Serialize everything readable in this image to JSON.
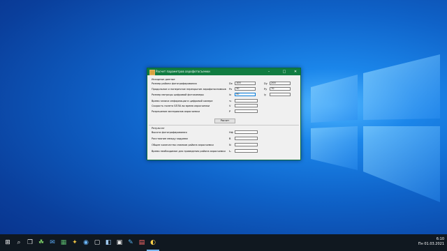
{
  "window": {
    "title": "Расчет параметров аэрофотосъемки",
    "minimize": "–",
    "maximize": "□",
    "close": "✕"
  },
  "input_section": {
    "heading": "Исходные данные",
    "rows": [
      {
        "label": "Размер района фотографирования",
        "sym1": "Dx",
        "val1": "100",
        "sym2": "Dy",
        "val2": "200"
      },
      {
        "label": "Продольное и поперечное перекрытие аэрофотоснимков",
        "sym1": "Px",
        "val1": "30",
        "sym2": "Py",
        "val2": "70"
      },
      {
        "label": "Размер матрицы цифровой фотокамеры",
        "sym1": "lx",
        "val1": "50",
        "sym2": "ly",
        "val2": ""
      }
    ],
    "single_rows": [
      {
        "label": "Время записи информации в цифровой камере",
        "sym": "τ₂",
        "val": ""
      },
      {
        "label": "Скорость полета БПЛА во время аэросъемки",
        "sym": "V",
        "val": ""
      },
      {
        "label": "Разрешение материалов аэросъемки",
        "sym": "P",
        "val": ""
      }
    ]
  },
  "calc_button": "Расчет",
  "results_section": {
    "heading": "Результат",
    "rows": [
      {
        "label": "Высота фотографирования",
        "sym": "Hф",
        "val": ""
      },
      {
        "label": "Расстояние между кадрами",
        "sym": "B",
        "val": ""
      },
      {
        "label": "Общее количество снимков района аэросъемки",
        "sym": "N",
        "val": ""
      },
      {
        "label": "Время необходимое для проведения района аэросъемки",
        "sym": "tₒ",
        "val": ""
      }
    ]
  },
  "taskbar": {
    "start": "⊞",
    "search": "⌕",
    "task_view": "❐",
    "apps": [
      "☘",
      "✉",
      "▦",
      "✦",
      "◉",
      "▢",
      "◧",
      "▣",
      "✎",
      "▤",
      "◐",
      "▥"
    ],
    "time": "6:10",
    "date": "Пн 01.03.2021"
  }
}
